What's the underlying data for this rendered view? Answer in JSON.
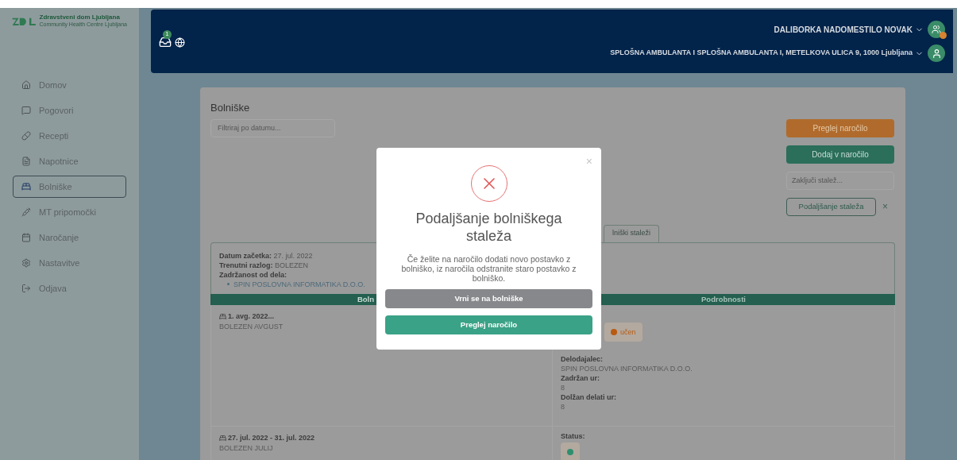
{
  "logo": {
    "title": "Zdravstveni dom Ljubljana",
    "subtitle": "Community Health Centre Ljubljana"
  },
  "sidebar": {
    "items": [
      {
        "label": "Domov",
        "selected": false
      },
      {
        "label": "Pogovori",
        "selected": false
      },
      {
        "label": "Recepti",
        "selected": false
      },
      {
        "label": "Napotnice",
        "selected": false
      },
      {
        "label": "Bolniške",
        "selected": true
      },
      {
        "label": "MT pripomočki",
        "selected": false
      },
      {
        "label": "Naročanje",
        "selected": false
      },
      {
        "label": "Nastavitve",
        "selected": false
      },
      {
        "label": "Odjava",
        "selected": false
      }
    ]
  },
  "header": {
    "notification_count": "1",
    "user": "DALIBORKA NADOMESTILO NOVAK",
    "location": "SPLOŠNA AMBULANTA I SPLOŠNA AMBULANTA I, METELKOVA ULICA 9, 1000 Ljubljana"
  },
  "page": {
    "title": "Bolniške",
    "filter": {
      "placeholder": "Filtriraj po datumu..."
    },
    "actions": [
      {
        "kind": "orange",
        "label": "Preglej naročilo"
      },
      {
        "kind": "green",
        "label": "Dodaj v naročilo"
      },
      {
        "kind": "field",
        "placeholder": "Zaključi stalež..."
      },
      {
        "kind": "outline",
        "label": "Podaljšanje staleža",
        "close": "×"
      }
    ],
    "tab": {
      "label": "lniški staleži",
      "selected": true
    },
    "info": {
      "fields": [
        {
          "label": "Datum začetka:",
          "value": "27. jul. 2022"
        },
        {
          "label": "Trenutni razlog:",
          "value": "BOLEZEN"
        },
        {
          "label": "Zadržanost od dela:"
        }
      ],
      "employers": [
        "SPIN POSLOVNA INFORMATIKA D.O.O."
      ]
    },
    "table": {
      "columns": [
        "Boln",
        "Podrobnosti"
      ],
      "rows": [
        {
          "date": "1. avg. 2022...",
          "reason": "BOLEZEN AVGUST",
          "status": {
            "text": "učen",
            "color": "#b85a10"
          },
          "details": [
            {
              "label": "Delodajalec:",
              "value": "SPIN POSLOVNA INFORMATIKA D.O.O."
            },
            {
              "label": "Zadržan ur:",
              "value": "8"
            },
            {
              "label": "Dolžan delati ur:",
              "value": "8"
            }
          ]
        },
        {
          "date": "27. jul. 2022 - 31. jul. 2022",
          "reason": "BOLEZEN JULIJ",
          "status_label": "Status:",
          "status": {
            "color": "#2f8f6f"
          },
          "details": []
        }
      ]
    }
  },
  "modal": {
    "close": "×",
    "title": "Podaljšanje bolniškega staleža",
    "message": "Če želite na naročilo dodati novo postavko z bolniško, iz naročila odstranite staro postavko z bolniško.",
    "buttons": [
      {
        "kind": "secondary",
        "label": "Vrni se na bolniške"
      },
      {
        "kind": "primary",
        "label": "Preglej naročilo"
      }
    ]
  }
}
